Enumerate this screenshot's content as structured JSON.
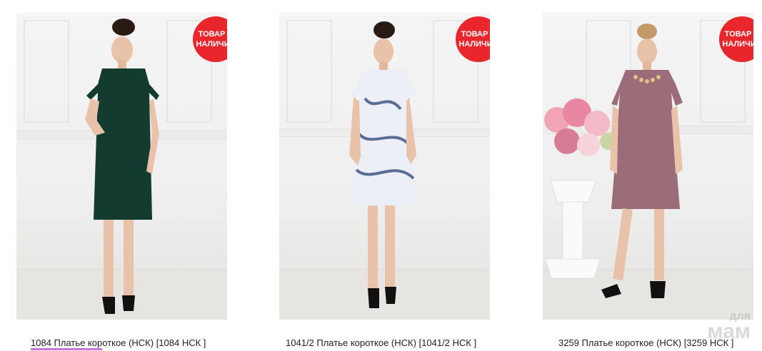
{
  "products": [
    {
      "badge": "ТОВАР В НАЛИЧИИ",
      "title": "1084 Платье короткое (НСК) [1084 НСК ]",
      "dress_color": "#133b30"
    },
    {
      "badge": "ТОВАР В НАЛИЧИИ",
      "title": "1041/2 Платье короткое (НСК) [1041/2 НСК ]",
      "dress_color": "#ecf0f6"
    },
    {
      "badge": "ТОВАР В НАЛИЧИИ",
      "title": "3259 Платье короткое (НСК) [3259 НСК ]",
      "dress_color": "#9a6d79"
    }
  ],
  "watermark": {
    "line1": "для",
    "line2": "мам"
  },
  "colors": {
    "badge": "#e8262b",
    "hover_underline": "#c874d8"
  }
}
